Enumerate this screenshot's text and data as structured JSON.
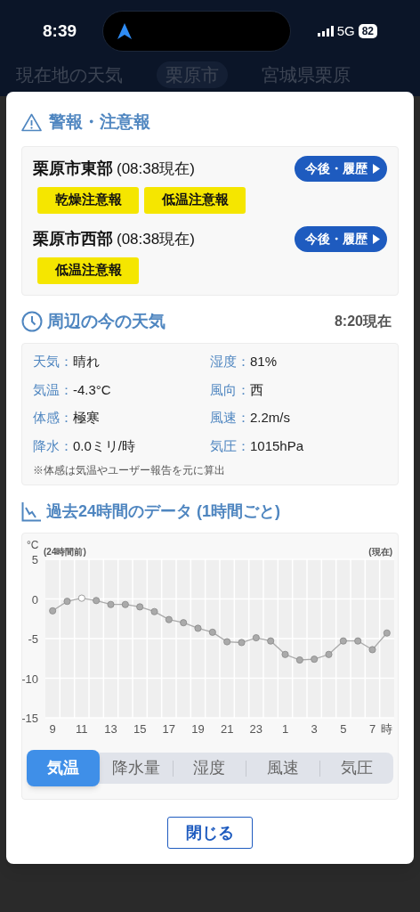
{
  "status_bar": {
    "time": "8:39",
    "network": "5G",
    "battery": "82"
  },
  "background_tabs": [
    {
      "label": "現在地の天気",
      "selected": false
    },
    {
      "label": "栗原市",
      "selected": true
    },
    {
      "label": "宮城県栗原",
      "selected": false
    }
  ],
  "warnings": {
    "title": "警報・注意報",
    "areas": [
      {
        "name": "栗原市東部",
        "time": "(08:38現在)",
        "button": "今後・履歴",
        "badges": [
          "乾燥注意報",
          "低温注意報"
        ]
      },
      {
        "name": "栗原市西部",
        "time": "(08:38現在)",
        "button": "今後・履歴",
        "badges": [
          "低温注意報"
        ]
      }
    ]
  },
  "current": {
    "title": "周辺の今の天気",
    "time": "8:20現在",
    "items": [
      {
        "label": "天気：",
        "value": "晴れ"
      },
      {
        "label": "湿度：",
        "value": "81%"
      },
      {
        "label": "気温：",
        "value": "-4.3°C"
      },
      {
        "label": "風向：",
        "value": "西"
      },
      {
        "label": "体感：",
        "value": "極寒"
      },
      {
        "label": "風速：",
        "value": "2.2m/s"
      },
      {
        "label": "降水：",
        "value": "0.0ミリ/時"
      },
      {
        "label": "気圧：",
        "value": "1015hPa"
      }
    ],
    "note": "※体感は気温やユーザー報告を元に算出"
  },
  "history": {
    "title": "過去24時間のデータ (1時間ごと)",
    "chart_data": {
      "type": "line",
      "xlabel": "時",
      "ylabel": "°C",
      "categories": [
        "9",
        null,
        "11",
        null,
        "13",
        null,
        "15",
        null,
        "17",
        null,
        "19",
        null,
        "21",
        null,
        "23",
        null,
        "1",
        null,
        "3",
        null,
        "5",
        null,
        "7",
        null
      ],
      "grid": true,
      "ylim": [
        -15,
        5
      ],
      "yticks": [
        5,
        0,
        -5,
        -10,
        -15
      ],
      "series": [
        {
          "color": "#aaaaaa",
          "marker": "circle",
          "values": [
            -1.5,
            -0.3,
            0.1,
            -0.2,
            -0.7,
            -0.7,
            -1.0,
            -1.6,
            -2.6,
            -3.0,
            -3.7,
            -4.2,
            -5.4,
            -5.5,
            -4.9,
            -5.3,
            -7.0,
            -7.7,
            -7.6,
            -7.0,
            -5.3,
            -5.3,
            -6.4,
            -4.3
          ]
        }
      ],
      "annotations": [
        "(24時間前)",
        "(現在)"
      ]
    },
    "tabs": [
      {
        "label": "気温",
        "selected": true
      },
      {
        "label": "降水量",
        "selected": false
      },
      {
        "label": "湿度",
        "selected": false
      },
      {
        "label": "風速",
        "selected": false
      },
      {
        "label": "気圧",
        "selected": false
      }
    ]
  },
  "close_button": "閉じる"
}
